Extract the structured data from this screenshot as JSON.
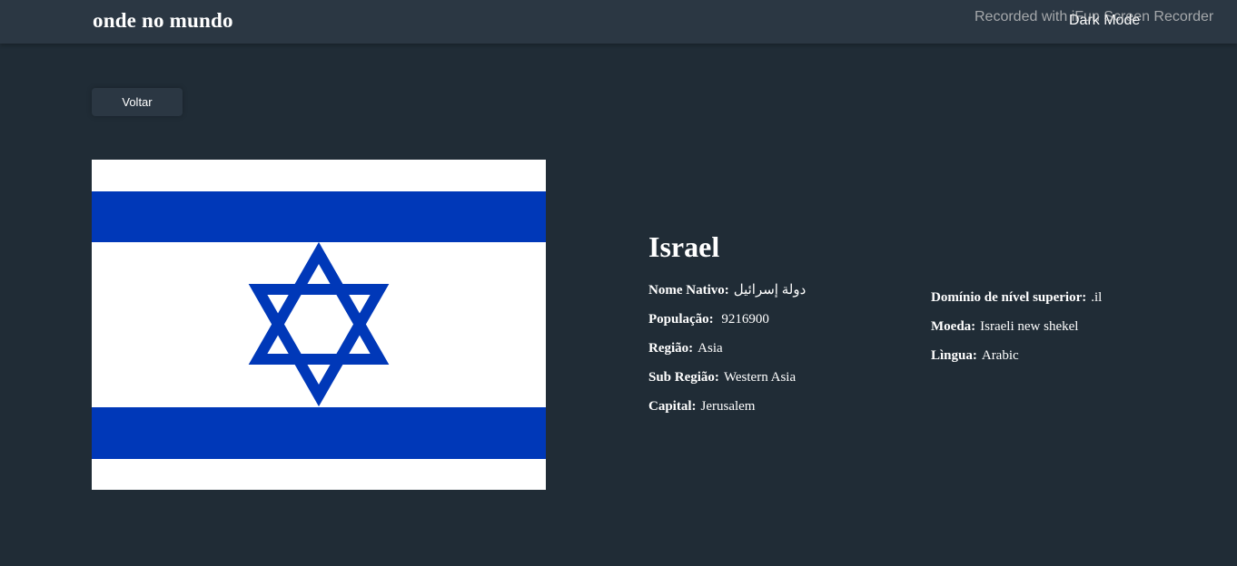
{
  "header": {
    "title": "onde no mundo",
    "mode_toggle": "Dark Mode",
    "watermark": "Recorded with iFun Screen Recorder"
  },
  "back_button": "Voltar",
  "flag": {
    "icon": "israel-flag",
    "colors": {
      "background": "#ffffff",
      "blue": "#0038b8"
    }
  },
  "country": {
    "name": "Israel",
    "details_left": [
      {
        "label": "Nome Nativo:",
        "value": " دولة إسرائيل"
      },
      {
        "label": "População:",
        "value": " 9216900"
      },
      {
        "label": "Região:",
        "value": "Asia"
      },
      {
        "label": "Sub Região:",
        "value": "Western Asia"
      },
      {
        "label": "Capital:",
        "value": "Jerusalem"
      }
    ],
    "details_right": [
      {
        "label": "Domínio de nível superior:",
        "value": ".il"
      },
      {
        "label": "Moeda:",
        "value": "Israeli new shekel"
      },
      {
        "label": "Lìngua:",
        "value": "Arabic"
      }
    ]
  },
  "colors": {
    "page_bg": "#202c36",
    "element_bg": "#2b3743",
    "text": "#ffffff"
  }
}
